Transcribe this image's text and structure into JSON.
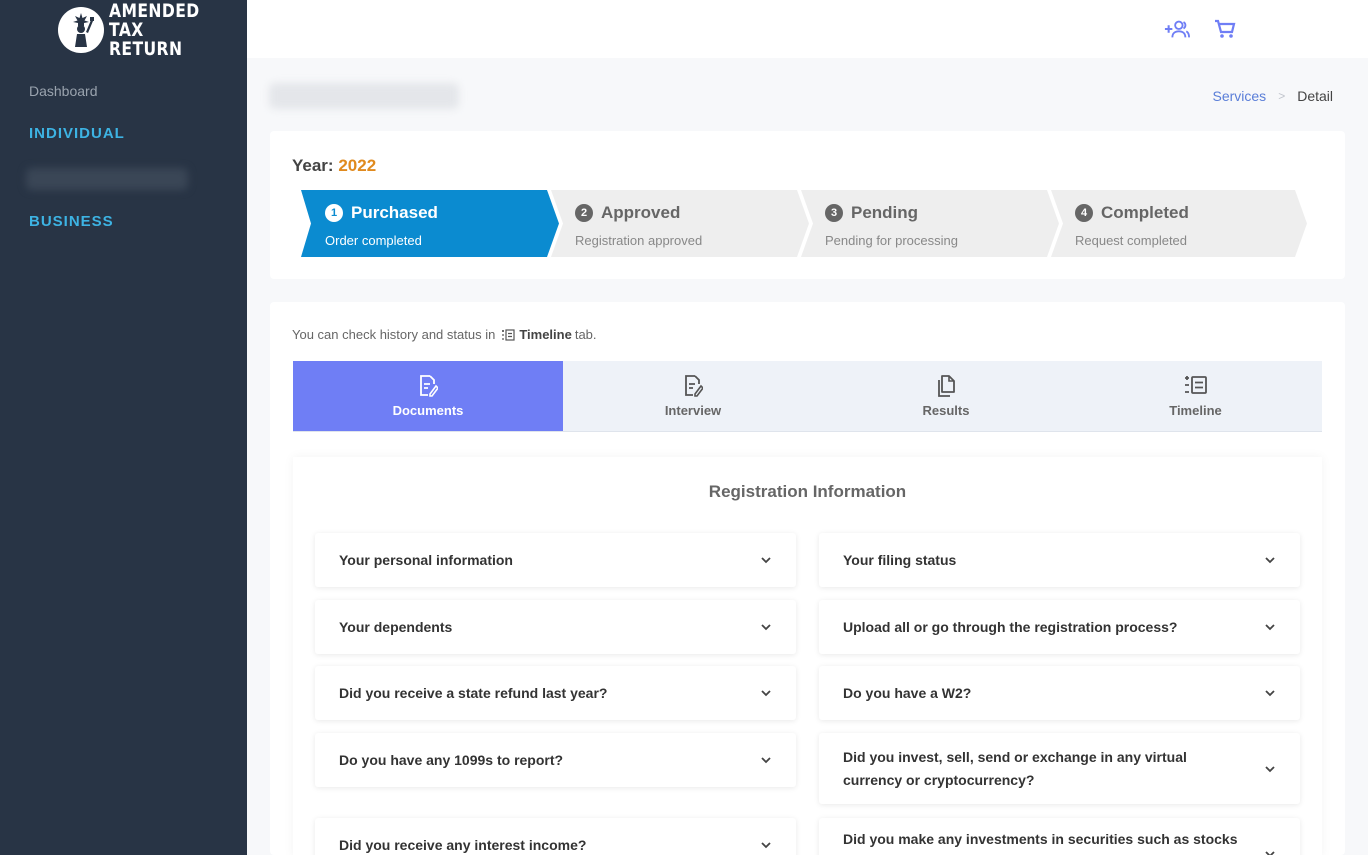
{
  "brand": {
    "line1": "AMENDED",
    "line2": "TAX RETURN"
  },
  "sidebar": {
    "dashboard": "Dashboard",
    "individual": "INDIVIDUAL",
    "business": "BUSINESS"
  },
  "header": {
    "add_user_icon": "add-user-icon",
    "cart_icon": "cart-icon"
  },
  "breadcrumb": {
    "parent": "Services",
    "separator": ">",
    "current": "Detail"
  },
  "year": {
    "label": "Year:",
    "value": "2022"
  },
  "steps": [
    {
      "num": "1",
      "title": "Purchased",
      "subtitle": "Order completed",
      "state": "active"
    },
    {
      "num": "2",
      "title": "Approved",
      "subtitle": "Registration approved",
      "state": "inactive"
    },
    {
      "num": "3",
      "title": "Pending",
      "subtitle": "Pending for processing",
      "state": "inactive"
    },
    {
      "num": "4",
      "title": "Completed",
      "subtitle": "Request completed",
      "state": "inactive"
    }
  ],
  "hint": {
    "before": "You can check history and status in",
    "link": "Timeline",
    "after": "tab."
  },
  "tabs": [
    {
      "label": "Documents",
      "icon": "document-edit-icon"
    },
    {
      "label": "Interview",
      "icon": "document-edit-icon"
    },
    {
      "label": "Results",
      "icon": "documents-icon"
    },
    {
      "label": "Timeline",
      "icon": "timeline-icon"
    }
  ],
  "registration": {
    "title": "Registration Information",
    "questions": [
      "Your personal information",
      "Your filing status",
      "Your dependents",
      "Upload all or go through the registration process?",
      "Did you receive a state refund last year?",
      "Do you have a W2?",
      "Do you have any 1099s to report?",
      "Did you invest, sell, send or exchange in any virtual currency or cryptocurrency?",
      "Did you receive any interest income?",
      "Did you make any investments in securities such as stocks or"
    ]
  },
  "colors": {
    "sidebar": "#283445",
    "accent": "#3db3e3",
    "step_active": "#0b8bd0",
    "tab_active": "#6f7ef5",
    "year": "#e08a1e"
  }
}
